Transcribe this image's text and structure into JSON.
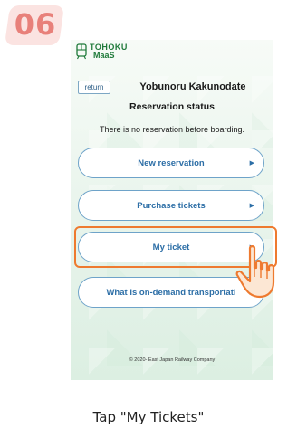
{
  "step": {
    "number": "06"
  },
  "app": {
    "logo_line1": "TOHOKU",
    "logo_line2": "MaaS",
    "logo_icon": "train-icon"
  },
  "header": {
    "return_label": "return",
    "station_name": "Yobunoru Kakunodate"
  },
  "screen": {
    "title": "Reservation status",
    "status_message": "There is no reservation before boarding."
  },
  "menu": [
    {
      "label": "New reservation",
      "icon": "chevron-right-icon"
    },
    {
      "label": "Purchase tickets",
      "icon": "chevron-right-icon"
    },
    {
      "label": "My ticket",
      "icon": "chevron-right-icon",
      "highlighted": true
    },
    {
      "label": "What is on-demand transportati",
      "icon": "chevron-right-icon"
    }
  ],
  "footer": {
    "copyright": "© 2020- East Japan Railway Company"
  },
  "instruction": {
    "caption": "Tap \"My Tickets\""
  },
  "colors": {
    "step_badge_bg": "#fbe3e1",
    "step_number": "#e8807a",
    "button_border": "#6ea3c9",
    "button_text": "#2c6ea6",
    "highlight": "#ee7a2f",
    "logo": "#1f7a3a"
  }
}
